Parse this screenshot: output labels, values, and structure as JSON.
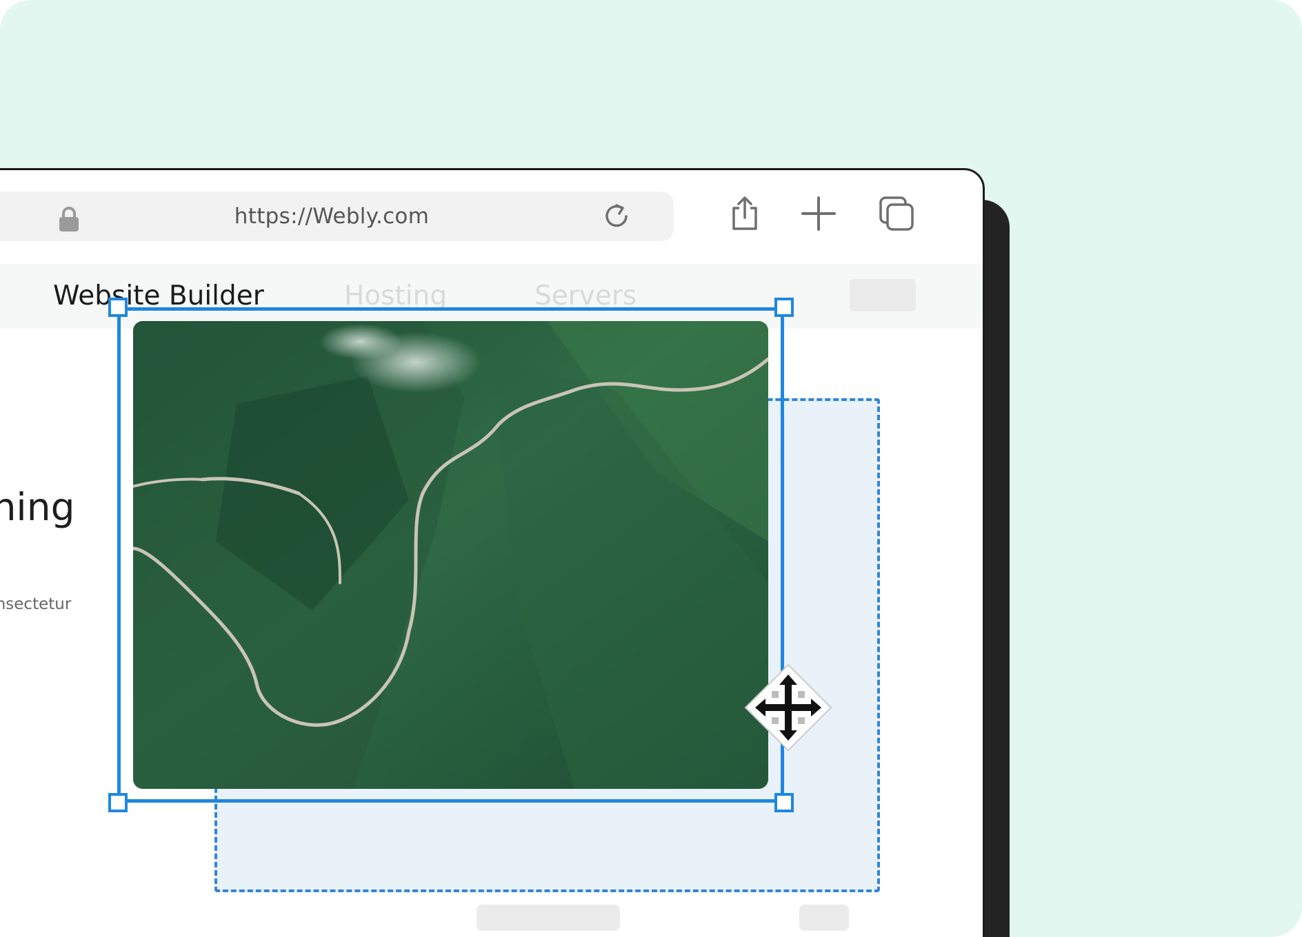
{
  "browser": {
    "url": "https://Webly.com",
    "icons": {
      "lock": "lock-icon",
      "reload": "reload-icon",
      "share": "share-icon",
      "new_tab": "plus-icon",
      "tabs": "tabs-icon"
    }
  },
  "nav": {
    "items": [
      "Website Builder",
      "Hosting",
      "Servers"
    ],
    "active_index": 0
  },
  "page": {
    "hero_fragment": "thing",
    "body_fragment": "consectetur"
  },
  "editor": {
    "selected_element": "image",
    "cursor": "move-cursor-icon"
  },
  "colors": {
    "background": "#e2f7ef",
    "selection": "#1f87e0",
    "drop_zone_fill": "#e9f1f9",
    "nav_active": "#1b1b1b",
    "nav_muted": "#d9d9d9"
  }
}
